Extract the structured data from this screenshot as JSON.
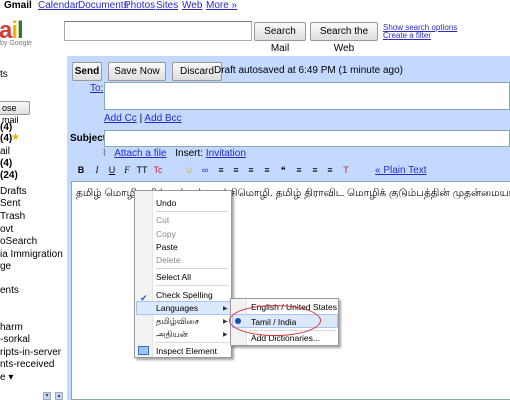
{
  "topnav": {
    "items": [
      "Gmail",
      "Calendar",
      "Documents",
      "Photos",
      "Sites",
      "Web",
      "More »"
    ]
  },
  "logo": {
    "word": "ail",
    "sub": "by Google"
  },
  "search": {
    "mail_button": "Search Mail",
    "web_button": "Search the Web",
    "show_options": "Show search options",
    "create_filter": "Create a filter"
  },
  "sidebar": {
    "items": [
      "ts",
      "ose mail",
      "(4)",
      "(4)",
      "ail",
      "(4)",
      "(24)",
      "Drafts",
      "Sent",
      "Trash",
      "ovt",
      "oSearch",
      "ia Immigration",
      "ge",
      "ents",
      "harm",
      "-sorkal",
      "ripts-in-server",
      "nts-received",
      "e ▾"
    ]
  },
  "compose": {
    "send": "Send",
    "save_now": "Save Now",
    "discard": "Discard",
    "draft_status": "Draft autosaved at 6:49 PM (1 minute ago)",
    "to_label": "To:",
    "add_cc": "Add Cc",
    "cc_separator": "|",
    "add_bcc": "Add Bcc",
    "subject_label": "Subject:",
    "attach": "Attach a file",
    "insert_label": "Insert:",
    "invitation": "Invitation",
    "plain_text": "« Plain Text",
    "body_text": "தமிழ் மொழி தமிழ்நாட்டின் ஆட்சிமொழி. தமிழ் திராவிட மொழிக் குடும்பத்தின் முதன்மையான மொழிகளு"
  },
  "toolbar": {
    "icons": [
      "B",
      "I",
      "U",
      "F",
      "TT",
      "Tc",
      "☺",
      "∞",
      "≡",
      "≡",
      "≡",
      "≡",
      "❝",
      "≡",
      "≡",
      "≡",
      "T"
    ]
  },
  "context_menu": {
    "undo": "Undo",
    "cut": "Cut",
    "copy": "Copy",
    "paste": "Paste",
    "delete": "Delete",
    "select_all": "Select All",
    "check_spelling": "Check Spelling",
    "languages": "Languages",
    "tamil_ime": "தமிழ்விசை",
    "dictionary": "அதியன்",
    "inspect": "Inspect Element"
  },
  "submenu": {
    "english": "English / United States",
    "tamil": "Tamil / India",
    "add_dict": "Add Dictionaries..."
  },
  "colors": {
    "compose_bg": "#c3d9ff",
    "link": "#2a2ac8",
    "highlight_oval": "#d43a3a",
    "menu_hover": "#dce8fb"
  }
}
